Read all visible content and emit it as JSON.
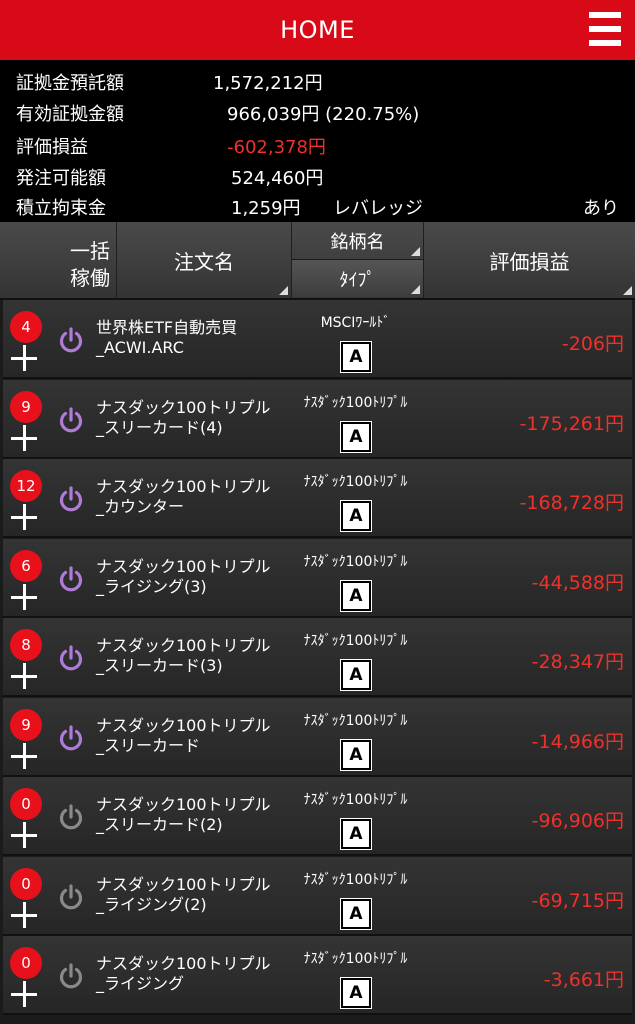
{
  "header": {
    "title": "HOME"
  },
  "summary": {
    "rows": [
      {
        "label": "証拠金預託額",
        "value": "1,572,212円"
      },
      {
        "label": "有効証拠金額",
        "value": "966,039円 (220.75%)"
      },
      {
        "label": "評価損益",
        "value": "-602,378円"
      },
      {
        "label": "発注可能額",
        "value": "524,460円"
      },
      {
        "label": "積立拘束金",
        "value": "1,259円"
      }
    ],
    "leverage_label": "レバレッジ",
    "leverage_value": "あり"
  },
  "table_header": {
    "batch_line1": "一括",
    "batch_line2": "稼働",
    "order_name": "注文名",
    "symbol": "銘柄名",
    "type": "ﾀｲﾌﾟ",
    "pl": "評価損益"
  },
  "orders": [
    {
      "count": "4",
      "name_line1": "世界株ETF自動売買",
      "name_line2": "_ACWI.ARC",
      "symbol": "MSCIﾜｰﾙﾄﾞ",
      "type": "A",
      "pl": "-206円",
      "active": true
    },
    {
      "count": "9",
      "name_line1": "ナスダック100トリプル",
      "name_line2": "_スリーカード(4)",
      "symbol": "ﾅｽﾀﾞｯｸ100ﾄﾘﾌﾟﾙ",
      "type": "A",
      "pl": "-175,261円",
      "active": true
    },
    {
      "count": "12",
      "name_line1": "ナスダック100トリプル",
      "name_line2": "_カウンター",
      "symbol": "ﾅｽﾀﾞｯｸ100ﾄﾘﾌﾟﾙ",
      "type": "A",
      "pl": "-168,728円",
      "active": true
    },
    {
      "count": "6",
      "name_line1": "ナスダック100トリプル",
      "name_line2": "_ライジング(3)",
      "symbol": "ﾅｽﾀﾞｯｸ100ﾄﾘﾌﾟﾙ",
      "type": "A",
      "pl": "-44,588円",
      "active": true
    },
    {
      "count": "8",
      "name_line1": "ナスダック100トリプル",
      "name_line2": "_スリーカード(3)",
      "symbol": "ﾅｽﾀﾞｯｸ100ﾄﾘﾌﾟﾙ",
      "type": "A",
      "pl": "-28,347円",
      "active": true
    },
    {
      "count": "9",
      "name_line1": "ナスダック100トリプル",
      "name_line2": "_スリーカード",
      "symbol": "ﾅｽﾀﾞｯｸ100ﾄﾘﾌﾟﾙ",
      "type": "A",
      "pl": "-14,966円",
      "active": true
    },
    {
      "count": "0",
      "name_line1": "ナスダック100トリプル",
      "name_line2": "_スリーカード(2)",
      "symbol": "ﾅｽﾀﾞｯｸ100ﾄﾘﾌﾟﾙ",
      "type": "A",
      "pl": "-96,906円",
      "active": false
    },
    {
      "count": "0",
      "name_line1": "ナスダック100トリプル",
      "name_line2": "_ライジング(2)",
      "symbol": "ﾅｽﾀﾞｯｸ100ﾄﾘﾌﾟﾙ",
      "type": "A",
      "pl": "-69,715円",
      "active": false
    },
    {
      "count": "0",
      "name_line1": "ナスダック100トリプル",
      "name_line2": "_ライジング",
      "symbol": "ﾅｽﾀﾞｯｸ100ﾄﾘﾌﾟﾙ",
      "type": "A",
      "pl": "-3,661円",
      "active": false
    }
  ],
  "colors": {
    "brand_red": "#d90a17",
    "loss_red": "#f0302a",
    "active_power": "#b07cd8",
    "inactive_power": "#8a8a8a"
  }
}
